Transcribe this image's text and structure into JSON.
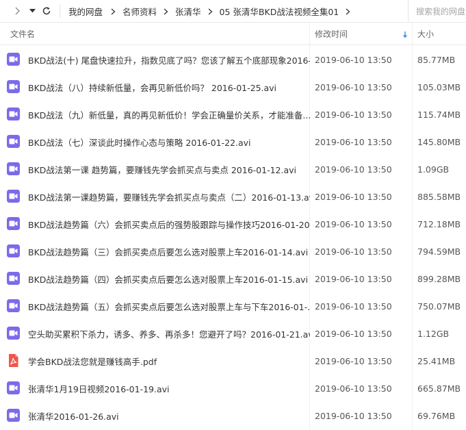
{
  "breadcrumb": [
    "我的网盘",
    "名师资料",
    "张清华",
    "05 张清华BKD战法视频全集01"
  ],
  "search": {
    "placeholder": "搜索我的网盘"
  },
  "columns": {
    "name": "文件名",
    "time": "修改时间",
    "size": "大小"
  },
  "colors": {
    "video_icon": "#7b6bea",
    "pdf_icon": "#f0564b",
    "sort_arrow": "#3b8cf0"
  },
  "files": [
    {
      "type": "video-icon",
      "name": "BKD战法(十) 尾盘快速拉升，指数见底了吗？您该了解五个底部现象2016-...",
      "time": "2019-06-10 13:50",
      "size": "85.77MB"
    },
    {
      "type": "video-icon",
      "name": "BKD战法（八）持续新低量，会再见新低价吗？ 2016-01-25.avi",
      "time": "2019-06-10 13:50",
      "size": "105.03MB"
    },
    {
      "type": "video-icon",
      "name": "BKD战法（九）新低量，真的再见新低价！学会正确量价关系，才能准备...",
      "time": "2019-06-10 13:50",
      "size": "115.74MB"
    },
    {
      "type": "video-icon",
      "name": "BKD战法（七）深谈此时操作心态与策略 2016-01-22.avi",
      "time": "2019-06-10 13:50",
      "size": "145.80MB"
    },
    {
      "type": "video-icon",
      "name": "BKD战法第一课 趋势篇，要赚钱先学会抓买点与卖点 2016-01-12.avi",
      "time": "2019-06-10 13:50",
      "size": "1.09GB"
    },
    {
      "type": "video-icon",
      "name": "BKD战法第一课趋势篇，要赚钱先学会抓买点与卖点（二）2016-01-13.avi",
      "time": "2019-06-10 13:50",
      "size": "885.58MB"
    },
    {
      "type": "video-icon",
      "name": "BKD战法趋势篇（六）会抓买卖点后的强势股跟踪与操作技巧2016-01-20....",
      "time": "2019-06-10 13:50",
      "size": "712.18MB"
    },
    {
      "type": "video-icon",
      "name": "BKD战法趋势篇（三）会抓买卖点后要怎么选对股票上车2016-01-14.avi",
      "time": "2019-06-10 13:50",
      "size": "794.59MB"
    },
    {
      "type": "video-icon",
      "name": "BKD战法趋势篇（四）会抓买卖点后要怎么选对股票上车2016-01-15.avi",
      "time": "2019-06-10 13:50",
      "size": "899.28MB"
    },
    {
      "type": "video-icon",
      "name": "BKD战法趋势篇（五）会抓买卖点后要怎么选对股票上车与下车2016-01-...",
      "time": "2019-06-10 13:50",
      "size": "750.07MB"
    },
    {
      "type": "video-icon",
      "name": "空头助买累积下杀力，诱多、养多、再杀多！您避开了吗？2016-01-21.avi",
      "time": "2019-06-10 13:50",
      "size": "1.12GB"
    },
    {
      "type": "pdf-icon",
      "name": "学会BKD战法您就是赚钱高手.pdf",
      "time": "2019-06-10 13:50",
      "size": "25.41MB"
    },
    {
      "type": "video-icon",
      "name": "张清华1月19日视频2016-01-19.avi",
      "time": "2019-06-10 13:50",
      "size": "665.87MB"
    },
    {
      "type": "video-icon",
      "name": "张清华2016-01-26.avi",
      "time": "2019-06-10 13:50",
      "size": "69.76MB"
    }
  ]
}
